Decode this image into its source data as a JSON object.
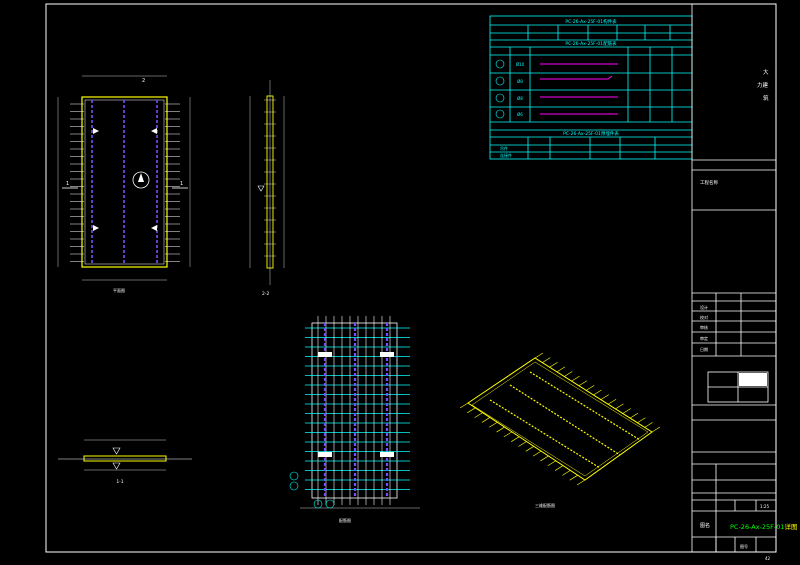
{
  "sheet": {
    "drawing_number": "PC-26-Ax-25F-01",
    "drawing_number_suffix": "详图",
    "page_number": "42",
    "company_text": [
      "大",
      "力建",
      "筑"
    ]
  },
  "tables": {
    "top_title": "PC-26-Ax-25F-01构件表",
    "mid_title": "PC-26-Ax-25F-01配筋表",
    "bottom_title": "PC-26-Ax-25F-01预埋件表",
    "mid_rows": [
      {
        "id": "①",
        "spec": "Ø10"
      },
      {
        "id": "②",
        "spec": "Ø8"
      },
      {
        "id": "③",
        "spec": "Ø8"
      },
      {
        "id": "④",
        "spec": "Ø6"
      }
    ],
    "bottom_rows": [
      {
        "id": "吊件"
      },
      {
        "id": "连接件"
      }
    ]
  },
  "views": {
    "plan_label": "平面图",
    "section_2_label": "2-2",
    "section_1_label": "1-1",
    "rebar_label": "配筋图",
    "iso_label": "三维配筋图",
    "cut_2": "2",
    "cut_1": "1"
  },
  "title_block": {
    "project_label": "工程名称",
    "scale": "1:25",
    "rows": [
      "设计",
      "校对",
      "审核",
      "审定",
      "日期"
    ],
    "footer_label": "图名",
    "page_label": "图号"
  },
  "colors": {
    "frame": "#ffffff",
    "table": "#00ffff",
    "rebar": "#ffff00",
    "rebar_alt": "#00ff00",
    "annot": "#ff00ff",
    "hatch": "#7a4cff",
    "highlight": "#ffff00"
  }
}
